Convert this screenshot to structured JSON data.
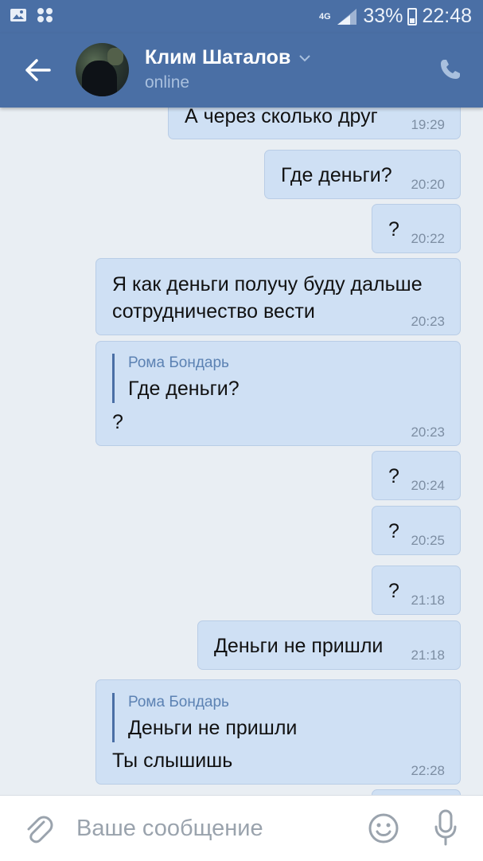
{
  "status_bar": {
    "network": "4G",
    "battery": "33%",
    "time": "22:48"
  },
  "header": {
    "contact_name": "Клим Шаталов",
    "presence": "online"
  },
  "messages": [
    {
      "text": "А через сколько друг",
      "time": "19:29"
    },
    {
      "text": "Где деньги?",
      "time": "20:20"
    },
    {
      "text": "?",
      "time": "20:22"
    },
    {
      "text": "Я как деньги получу буду дальше\nсотрудничество вести",
      "time": "20:23"
    },
    {
      "quote_author": "Рома Бондарь",
      "quote_text": "Где деньги?",
      "text": "?",
      "time": "20:23"
    },
    {
      "text": "?",
      "time": "20:24"
    },
    {
      "text": "?",
      "time": "20:25"
    },
    {
      "text": "?",
      "time": "21:18"
    },
    {
      "text": "Деньги не пришли",
      "time": "21:18"
    },
    {
      "quote_author": "Рома Бондарь",
      "quote_text": "Деньги не пришли",
      "text": "Ты слышишь",
      "time": "22:28"
    }
  ],
  "composer": {
    "placeholder": "Ваше сообщение"
  },
  "colors": {
    "header": "#4a6fa5",
    "bubble": "#cfe0f4",
    "background": "#e9eef3"
  }
}
